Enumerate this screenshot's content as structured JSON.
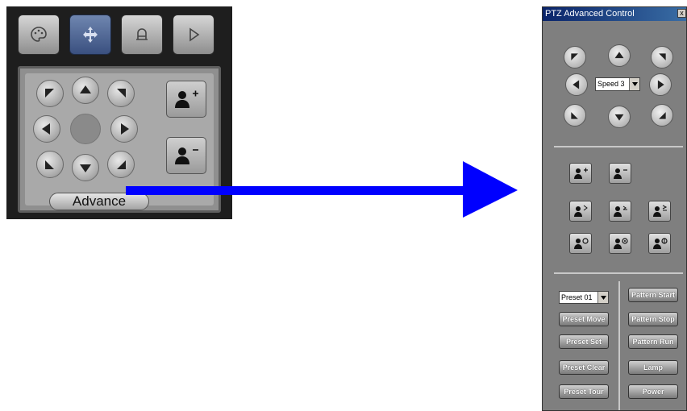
{
  "basic_panel": {
    "tabs": [
      {
        "icon": "palette-icon"
      },
      {
        "icon": "ptz-move-icon",
        "active": true
      },
      {
        "icon": "lamp-icon"
      },
      {
        "icon": "play-icon"
      }
    ],
    "advance_label": "Advance"
  },
  "advanced_window": {
    "title": "PTZ Advanced Control",
    "close_label": "x",
    "speed": {
      "selected": "Speed 3"
    },
    "preset": {
      "selected": "Preset 01"
    },
    "buttons": {
      "preset_move": "Preset Move",
      "preset_set": "Preset Set",
      "preset_clear": "Preset Clear",
      "preset_tour": "Preset Tour",
      "pattern_start": "Pattern Start",
      "pattern_stop": "Pattern Stop",
      "pattern_run": "Pattern Run",
      "lamp": "Lamp",
      "power": "Power"
    }
  },
  "colors": {
    "arrow": "#0000ff",
    "title_bar": "#0a246a",
    "active_tab": "#4a6090"
  }
}
